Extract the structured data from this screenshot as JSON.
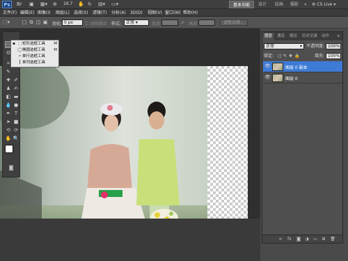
{
  "titlebar": {
    "logo": "Ps",
    "zoom": "16.7",
    "workspace_buttons": [
      "基本功能",
      "设计",
      "绘画",
      "摄影"
    ],
    "more": "»",
    "cs_live": "CS Live"
  },
  "menu": [
    "文件(F)",
    "编辑(E)",
    "图像(I)",
    "图层(L)",
    "选择(S)",
    "滤镜(T)",
    "分析(A)",
    "3D(D)",
    "视图(V)",
    "窗口(W)",
    "帮助(H)"
  ],
  "options": {
    "feather_label": "羽化:",
    "feather_value": "0 px",
    "antialias_label": "消除锯齿",
    "style_label": "样式:",
    "style_value": "正常",
    "width_label": "宽度:",
    "height_label": "高度:",
    "refine_button": "调整边缘..."
  },
  "flyout": [
    {
      "label": "矩形选框工具",
      "shortcut": "M",
      "icon": "rect-marquee-icon",
      "selected": true
    },
    {
      "label": "椭圆选框工具",
      "shortcut": "M",
      "icon": "ellipse-marquee-icon",
      "selected": false
    },
    {
      "label": "单行选框工具",
      "shortcut": "",
      "icon": "single-row-icon",
      "selected": false
    },
    {
      "label": "单列选框工具",
      "shortcut": "",
      "icon": "single-column-icon",
      "selected": false
    }
  ],
  "layers_panel": {
    "tabs": [
      "图层",
      "通道",
      "路径",
      "历史记录",
      "动作"
    ],
    "blend_mode": "正常",
    "opacity_label": "不透明度:",
    "opacity_value": "100%",
    "lock_label": "锁定:",
    "fill_label": "填充:",
    "fill_value": "100%",
    "layers": [
      {
        "name": "图层 0 副本",
        "selected": true
      },
      {
        "name": "图层 0",
        "selected": false
      }
    ]
  }
}
